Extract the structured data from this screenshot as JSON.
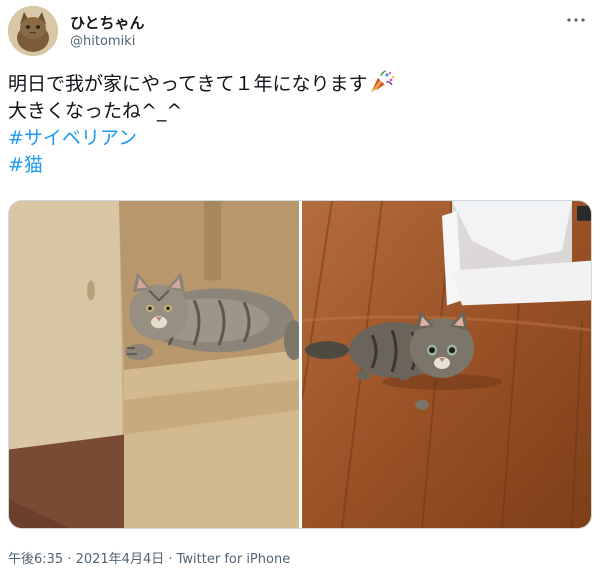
{
  "user": {
    "display_name": "ひとちゃん",
    "handle": "@hitomiki",
    "avatar_icon": "cat-avatar"
  },
  "menu_icon": "more-options-icon",
  "tweet": {
    "line1": "明日で我が家にやってきて１年になります",
    "line1_emoji": "party-popper-icon",
    "line2": "大きくなったね^_^",
    "hashtag1": "#サイベリアン",
    "hashtag2": "#猫"
  },
  "media": {
    "photos": [
      "adult-cat-in-box-photo",
      "kitten-on-floor-photo"
    ]
  },
  "meta": {
    "timestamp": "午後6:35 · 2021年4月4日 · Twitter for iPhone"
  },
  "colors": {
    "text": "#0f1419",
    "secondary": "#536471",
    "hashtag": "#1d9bf0",
    "border": "#cfd9de"
  }
}
